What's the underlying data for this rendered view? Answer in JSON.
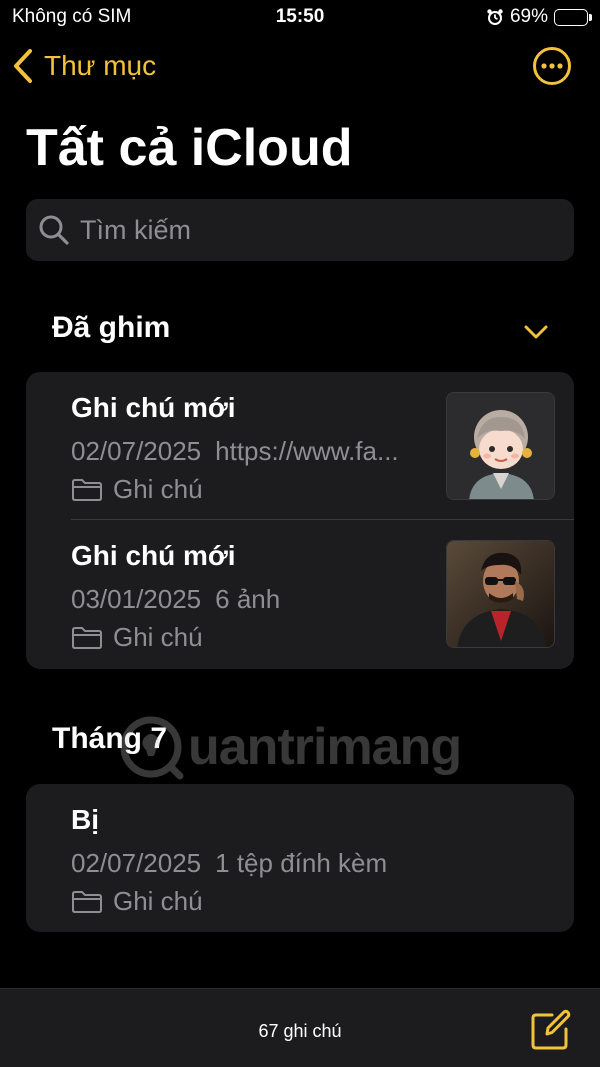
{
  "status": {
    "carrier": "Không có SIM",
    "time": "15:50",
    "battery": "69%",
    "battery_level": 0.69
  },
  "nav": {
    "back_label": "Thư mục"
  },
  "page_title": "Tất cả iCloud",
  "search": {
    "placeholder": "Tìm kiếm"
  },
  "sections": {
    "pinned": {
      "header": "Đã ghim",
      "notes": [
        {
          "title": "Ghi chú mới",
          "date": "02/07/2025",
          "preview": "https://www.fa...",
          "folder": "Ghi chú",
          "thumb": "avatar-cartoon-image"
        },
        {
          "title": "Ghi chú mới",
          "date": "03/01/2025",
          "preview": "6 ảnh",
          "folder": "Ghi chú",
          "thumb": "man-sunglasses-photo"
        }
      ]
    },
    "month": {
      "header": "Tháng 7",
      "notes": [
        {
          "title": "Bị",
          "date": "02/07/2025",
          "preview": "1 tệp đính kèm",
          "folder": "Ghi chú"
        }
      ]
    }
  },
  "footer": {
    "count": "67 ghi chú"
  },
  "watermark": {
    "text": "uantrimang"
  },
  "colors": {
    "accent": "#f2c23c",
    "card": "#1c1c1e",
    "secondary_text": "#8e8e93",
    "background": "#000000"
  }
}
